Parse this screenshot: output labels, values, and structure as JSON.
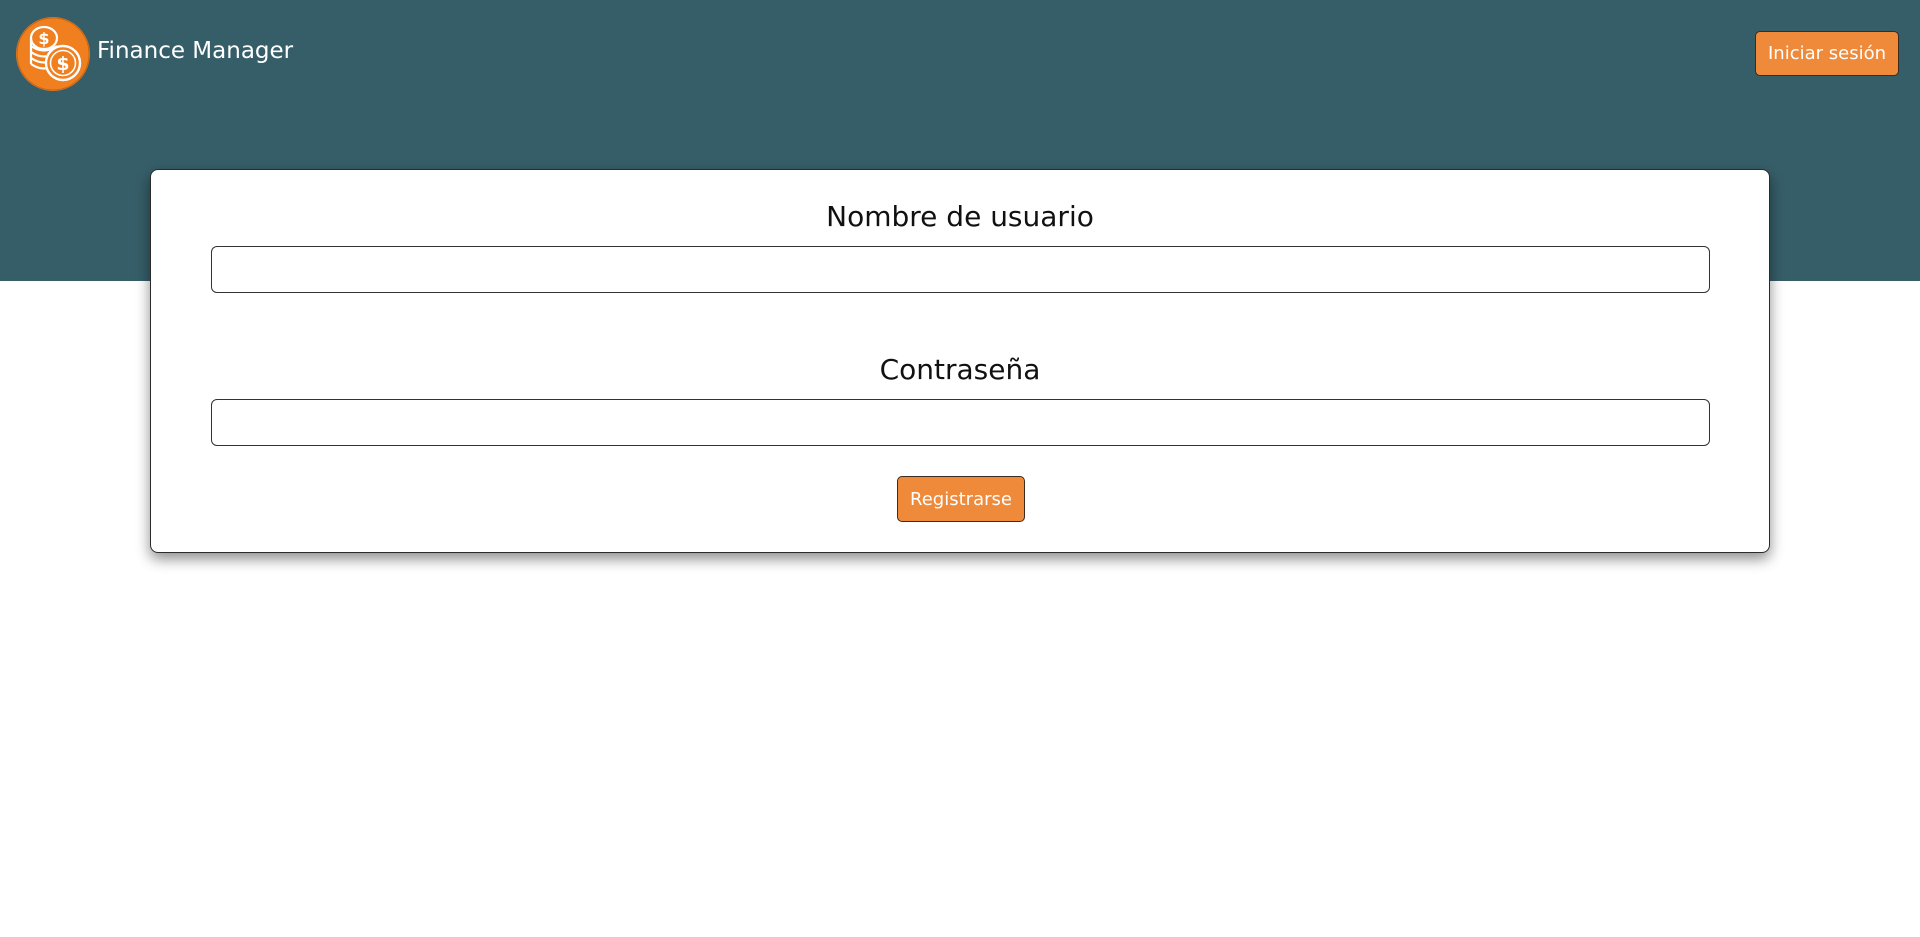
{
  "header": {
    "logo_icon": "coins-dollar-icon",
    "brand": "Finance Manager",
    "login_label": "Iniciar sesión"
  },
  "form": {
    "username_label": "Nombre de usuario",
    "username_value": "",
    "password_label": "Contraseña",
    "password_value": "",
    "submit_label": "Registrarse"
  },
  "colors": {
    "header_bg": "#365e69",
    "accent": "#ef8a3a",
    "page_bg": "#ffffff"
  }
}
